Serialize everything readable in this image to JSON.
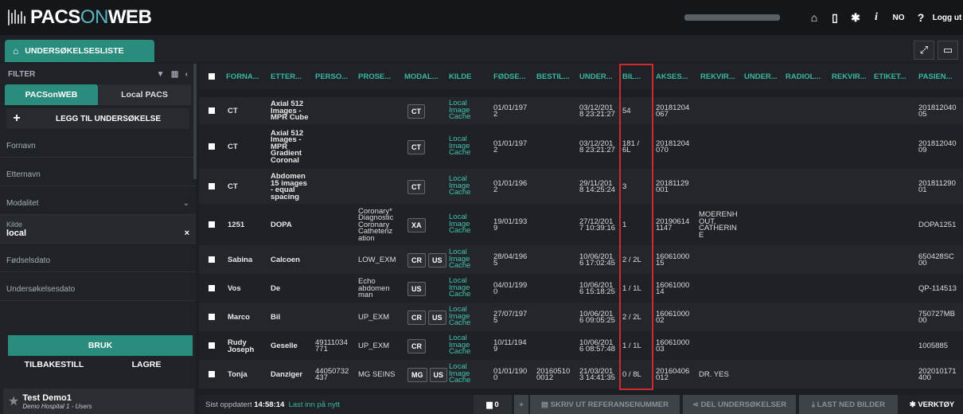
{
  "app": {
    "logo_part1": "PACS",
    "logo_part2": "ON",
    "logo_part3": "WEB"
  },
  "topbar": {
    "home": "⌂",
    "device": "▯",
    "settings": "✱",
    "info": "i",
    "language": "NO",
    "help": "?",
    "logout": "Logg ut"
  },
  "tab": {
    "label": "UNDERSØKELSESLISTE"
  },
  "sidebar": {
    "filter_title": "FILTER",
    "source_tabs": [
      "PACSonWEB",
      "Local PACS"
    ],
    "add_label": "LEGG TIL UNDERSØKELSE",
    "fields": [
      "Fornavn",
      "Etternavn"
    ],
    "modalitet": "Modalitet",
    "kilde_label": "Kilde",
    "kilde_value": "local",
    "dob": "Fødselsdato",
    "exam_date": "Undersøkelsesdato",
    "apply": "BRUK",
    "reset": "TILBAKESTILL",
    "save": "LAGRE",
    "user_name": "Test Demo1",
    "user_sub": "Demo Hospital 1 - Users"
  },
  "table": {
    "headers": [
      "FORNA...",
      "ETTER...",
      "PERSO...",
      "PROSE...",
      "MODAL...",
      "KILDE",
      "FØDSE...",
      "BESTIL...",
      "UNDER...",
      "BIL...",
      "AKSES...",
      "REKVIR...",
      "UNDER...",
      "RADIOL...",
      "REKVIR...",
      "ETIKET...",
      "PASIEN..."
    ],
    "rows": [
      {
        "first": "CT",
        "last": [
          "Axial 512",
          "Images -",
          "MPR Cube"
        ],
        "pnr": [],
        "proc": [],
        "mod": [
          "CT"
        ],
        "src": [
          "Local",
          "Image",
          "Cache"
        ],
        "dob": [
          "01/01/197",
          "2"
        ],
        "order": [],
        "date": [
          "03/12/201",
          "8 23:21:27"
        ],
        "img": [
          "54"
        ],
        "acc": [
          "20181204",
          "067"
        ],
        "req": [],
        "pid": [
          "201812040",
          "05"
        ]
      },
      {
        "first": "CT",
        "last": [
          "Axial 512",
          "Images -",
          "MPR",
          "Gradient",
          "Coronal"
        ],
        "pnr": [],
        "proc": [],
        "mod": [
          "CT"
        ],
        "src": [
          "Local",
          "Image",
          "Cache"
        ],
        "dob": [
          "01/01/197",
          "2"
        ],
        "order": [],
        "date": [
          "03/12/201",
          "8 23:21:27"
        ],
        "img": [
          "181 /",
          "6L"
        ],
        "acc": [
          "20181204",
          "070"
        ],
        "req": [],
        "pid": [
          "201812040",
          "09"
        ]
      },
      {
        "first": "CT",
        "last": [
          "Abdomen",
          "15 images",
          "- equal",
          "spacing"
        ],
        "pnr": [],
        "proc": [],
        "mod": [
          "CT"
        ],
        "src": [
          "Local",
          "Image",
          "Cache"
        ],
        "dob": [
          "01/01/196",
          "2"
        ],
        "order": [],
        "date": [
          "29/11/201",
          "8 14:25:24"
        ],
        "img": [
          "3"
        ],
        "acc": [
          "20181129",
          "001"
        ],
        "req": [],
        "pid": [
          "201811290",
          "01"
        ]
      },
      {
        "first": "1251",
        "last": [
          "DOPA"
        ],
        "pnr": [],
        "proc": [
          "Coronary*",
          "Diagnostic",
          "Coronary",
          "Catheteriz",
          "ation"
        ],
        "mod": [
          "XA"
        ],
        "src": [
          "Local",
          "Image",
          "Cache"
        ],
        "dob": [
          "19/01/193",
          "9"
        ],
        "order": [],
        "date": [
          "27/12/201",
          "7 10:39:16"
        ],
        "img": [
          "1"
        ],
        "acc": [
          "20190614",
          "1147"
        ],
        "req": [
          "MOERENH",
          "OUT,",
          "CATHERIN",
          "E"
        ],
        "pid": [
          "DOPA1251"
        ]
      },
      {
        "first": "Sabina",
        "last": [
          "Calcoen"
        ],
        "pnr": [],
        "proc": [
          "LOW_EXM"
        ],
        "mod": [
          "CR",
          "US"
        ],
        "src": [
          "Local",
          "Image",
          "Cache"
        ],
        "dob": [
          "28/04/196",
          "5"
        ],
        "order": [],
        "date": [
          "10/06/201",
          "6 17:02:45"
        ],
        "img": [
          "2 / 2L"
        ],
        "acc": [
          "16061000",
          "15"
        ],
        "req": [],
        "pid": [
          "650428SC",
          "00"
        ]
      },
      {
        "first": "Vos",
        "last": [
          "De"
        ],
        "pnr": [],
        "proc": [
          "Echo",
          "abdomen",
          "man"
        ],
        "mod": [
          "US"
        ],
        "src": [
          "Local",
          "Image",
          "Cache"
        ],
        "dob": [
          "04/01/199",
          "0"
        ],
        "order": [],
        "date": [
          "10/06/201",
          "6 15:18:25"
        ],
        "img": [
          "1 / 1L"
        ],
        "acc": [
          "16061000",
          "14"
        ],
        "req": [],
        "pid": [
          "QP-114513"
        ]
      },
      {
        "first": "Marco",
        "last": [
          "Bil"
        ],
        "pnr": [],
        "proc": [
          "UP_EXM"
        ],
        "mod": [
          "CR",
          "US"
        ],
        "src": [
          "Local",
          "Image",
          "Cache"
        ],
        "dob": [
          "27/07/197",
          "5"
        ],
        "order": [],
        "date": [
          "10/06/201",
          "6 09:05:25"
        ],
        "img": [
          "2 / 2L"
        ],
        "acc": [
          "16061000",
          "02"
        ],
        "req": [],
        "pid": [
          "750727MB",
          "00"
        ]
      },
      {
        "first": "Rudy\nJoseph",
        "last": [
          "Geselle"
        ],
        "pnr": [
          "49111034",
          "771"
        ],
        "proc": [
          "UP_EXM"
        ],
        "mod": [
          "CR"
        ],
        "src": [
          "Local",
          "Image",
          "Cache"
        ],
        "dob": [
          "10/11/194",
          "9"
        ],
        "order": [],
        "date": [
          "10/06/201",
          "6 08:57:48"
        ],
        "img": [
          "1 / 1L"
        ],
        "acc": [
          "16061000",
          "03"
        ],
        "req": [],
        "pid": [
          "1005885"
        ]
      },
      {
        "first": "Tonja",
        "last": [
          "Danziger"
        ],
        "pnr": [
          "44050732",
          "437"
        ],
        "proc": [
          "MG SEINS"
        ],
        "mod": [
          "MG",
          "US"
        ],
        "src": [
          "Local",
          "Image",
          "Cache"
        ],
        "dob": [
          "01/01/190",
          "0"
        ],
        "order": [
          "20160510",
          "0012"
        ],
        "date": [
          "21/03/201",
          "3 14:41:35"
        ],
        "img": [
          "0 / 8L"
        ],
        "acc": [
          "20160406",
          "012"
        ],
        "req": [
          "DR. YES"
        ],
        "pid": [
          "202010171",
          "400"
        ]
      }
    ]
  },
  "footer": {
    "updated_prefix": "Sist oppdatert ",
    "updated_time": "14:58:14",
    "last_link": "Last inn på nytt",
    "folder_count": "0",
    "print": "SKRIV UT REFERANSENUMMER",
    "share": "DEL UNDERSØKELSER",
    "download": "LAST NED BILDER",
    "tools": "VERKTØY"
  },
  "colors": {
    "accent": "#2a8c7c",
    "header_text": "#3bb5a2",
    "highlight": "#d12a2a"
  }
}
